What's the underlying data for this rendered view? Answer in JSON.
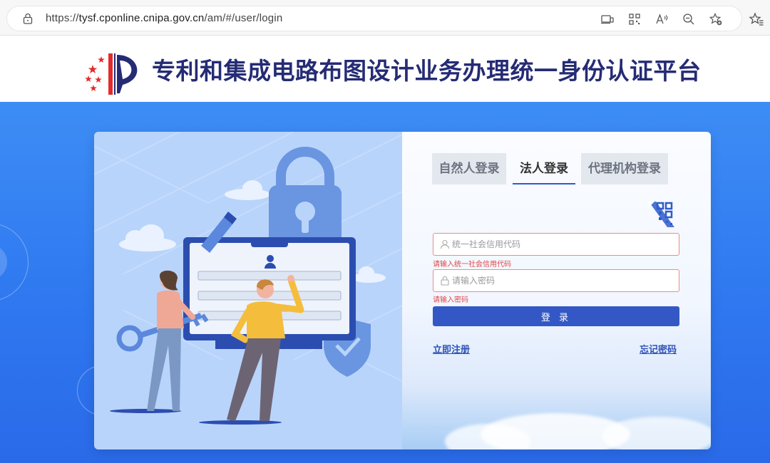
{
  "browser": {
    "url_prefix": "https://",
    "url_host": "tysf.cponline.cnipa.gov.cn",
    "url_path": "/am/#/user/login"
  },
  "header": {
    "title": "专利和集成电路布图设计业务办理统一身份认证平台"
  },
  "login": {
    "tabs": [
      {
        "label": "自然人登录",
        "active": false
      },
      {
        "label": "法人登录",
        "active": true
      },
      {
        "label": "代理机构登录",
        "active": false
      }
    ],
    "credit_code_placeholder": "统一社会信用代码",
    "credit_code_error": "请输入统一社会信用代码",
    "password_placeholder": "请输入密码",
    "password_error": "请输入密码",
    "submit_label": "登 录",
    "register_link": "立即注册",
    "forgot_link": "忘记密码"
  },
  "colors": {
    "brand_navy": "#252b74",
    "primary_button": "#3358c6",
    "error": "#e04848",
    "background_blue": "#2f78f0"
  }
}
